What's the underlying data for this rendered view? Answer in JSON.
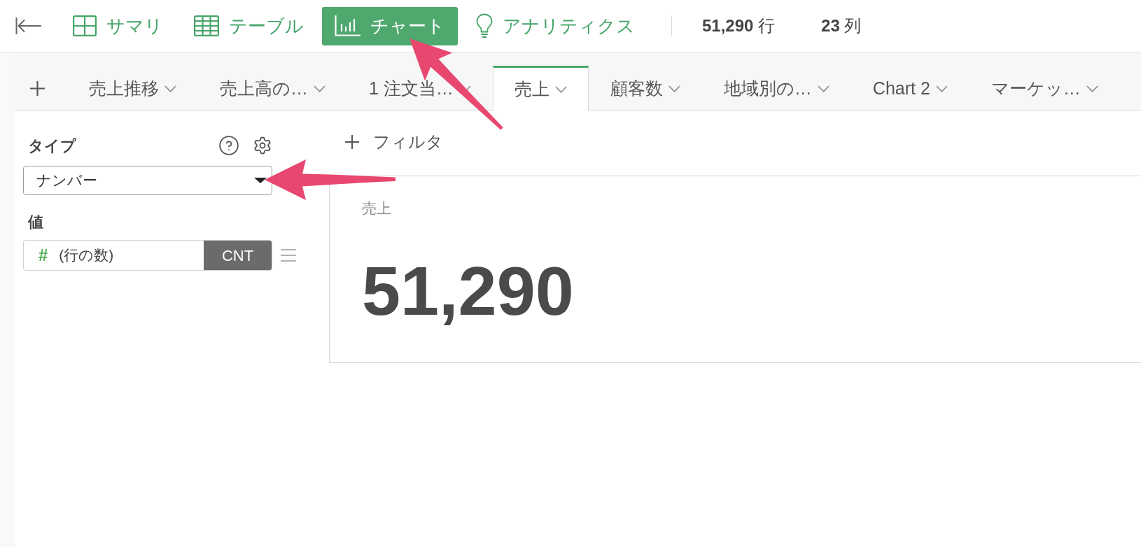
{
  "toolbar": {
    "nav": [
      {
        "kind": "summary",
        "label": "サマリ",
        "selected": false
      },
      {
        "kind": "table",
        "label": "テーブル",
        "selected": false
      },
      {
        "kind": "chart",
        "label": "チャート",
        "selected": true
      },
      {
        "kind": "analytics",
        "label": "アナリティクス",
        "selected": false
      }
    ],
    "stats": [
      {
        "value": "51,290",
        "unit": "行"
      },
      {
        "value": "23",
        "unit": "列"
      }
    ]
  },
  "chart_tabs": [
    {
      "label": "売上推移",
      "selected": false
    },
    {
      "label": "売上高の…",
      "selected": false
    },
    {
      "label": "1 注文当…",
      "selected": false
    },
    {
      "label": "売上",
      "selected": true
    },
    {
      "label": "顧客数",
      "selected": false
    },
    {
      "label": "地域別の…",
      "selected": false
    },
    {
      "label": "Chart 2",
      "selected": false
    },
    {
      "label": "マーケッ…",
      "selected": false
    }
  ],
  "sidebar": {
    "type_label": "タイプ",
    "type_select": {
      "value": "ナンバー"
    },
    "value_label": "値",
    "value_field": {
      "symbol": "#",
      "field": "(行の数)",
      "aggregation": "CNT"
    }
  },
  "filter": {
    "label": "フィルタ"
  },
  "card": {
    "title": "売上",
    "value": "51,290"
  }
}
